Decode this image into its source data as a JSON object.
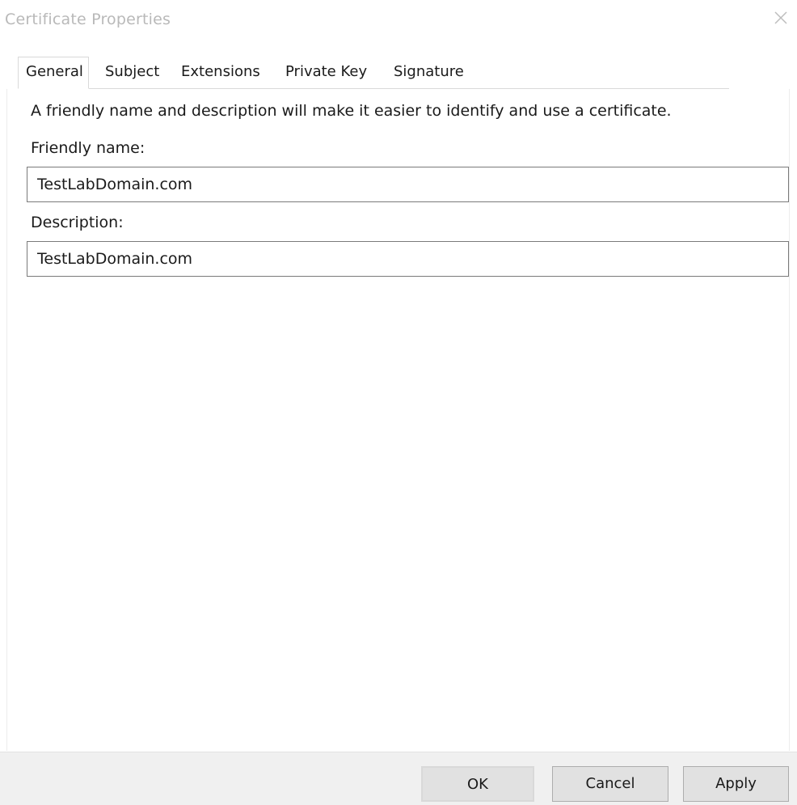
{
  "window": {
    "title": "Certificate Properties",
    "close_icon": "close-icon"
  },
  "tabs": [
    {
      "label": "General",
      "active": true
    },
    {
      "label": "Subject",
      "active": false
    },
    {
      "label": "Extensions",
      "active": false
    },
    {
      "label": "Private Key",
      "active": false
    },
    {
      "label": "Signature",
      "active": false
    }
  ],
  "general": {
    "intro": "A friendly name and description will make it easier to identify and use a certificate.",
    "friendly_name_label": "Friendly name:",
    "friendly_name_value": "TestLabDomain.com",
    "description_label": "Description:",
    "description_value": "TestLabDomain.com"
  },
  "buttons": {
    "ok": "OK",
    "cancel": "Cancel",
    "apply": "Apply"
  },
  "colors": {
    "title_text": "#b9b9b9",
    "footer_bg": "#f0f0f0",
    "button_bg": "#e1e1e1",
    "textbox_border": "#7a7a7a"
  }
}
